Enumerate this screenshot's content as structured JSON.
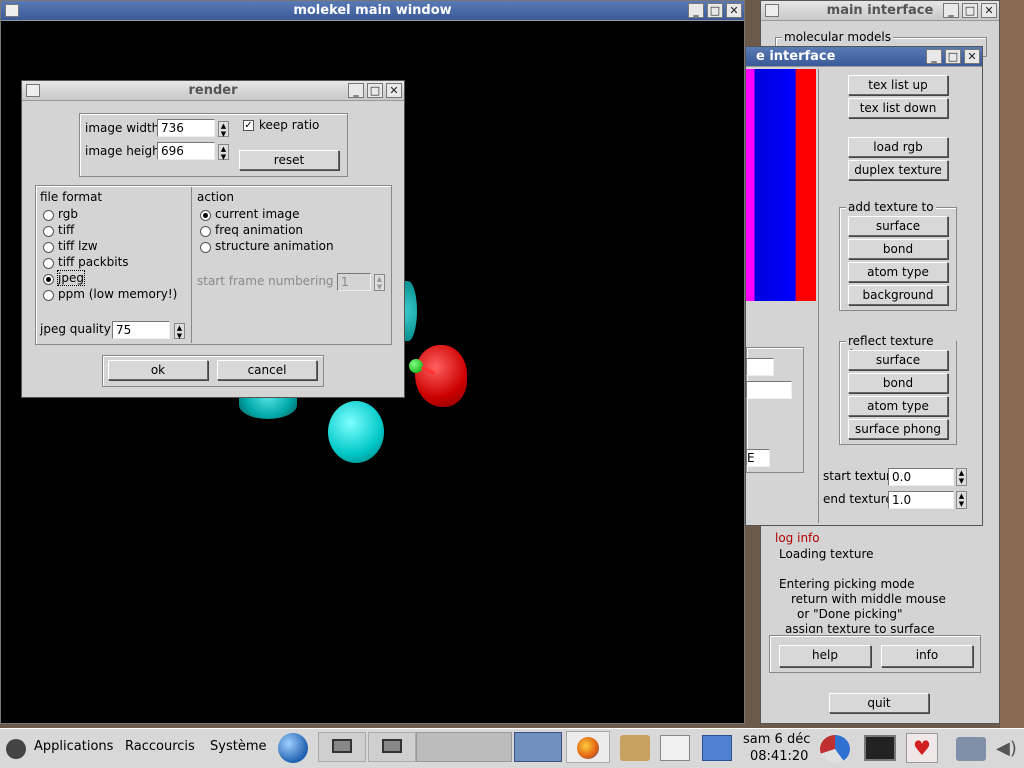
{
  "molekel_window": {
    "title": "molekel main window"
  },
  "render_dialog": {
    "title": "render",
    "image_width_label": "image width",
    "image_width_value": "736",
    "image_height_label": "image height",
    "image_height_value": "696",
    "keep_ratio_label": "keep ratio",
    "reset_label": "reset",
    "file_format_label": "file format",
    "formats": [
      "rgb",
      "tiff",
      "tiff lzw",
      "tiff packbits",
      "jpeg",
      "ppm (low memory!)"
    ],
    "selected_format": "jpeg",
    "action_label": "action",
    "actions": [
      "current image",
      "freq animation",
      "structure animation"
    ],
    "selected_action": "current image",
    "start_frame_label": "start frame numbering at",
    "start_frame_value": "1",
    "jpeg_quality_label": "jpeg quality",
    "jpeg_quality_value": "75",
    "ok_label": "ok",
    "cancel_label": "cancel"
  },
  "main_interface": {
    "title": "main interface",
    "molecular_models_label": "molecular models",
    "log_info_label": "log info",
    "log_lines": [
      "Loading texture",
      "",
      "Entering picking mode",
      "return with middle mouse",
      "or \"Done picking\"",
      "assign texture to surface"
    ],
    "help_label": "help",
    "info_label": "info",
    "quit_label": "quit"
  },
  "texture_interface": {
    "title": "e interface",
    "tex_list_up": "tex list up",
    "tex_list_down": "tex list down",
    "load_rgb": "load rgb",
    "duplex_texture": "duplex texture",
    "add_texture_to_label": "add texture to",
    "add_texture_items": [
      "surface",
      "bond",
      "atom type",
      "background"
    ],
    "reflect_texture_from_label": "reflect texture from",
    "reflect_texture_items": [
      "surface",
      "bond",
      "atom type",
      "surface phong"
    ],
    "start_texture_label": "start texture",
    "start_texture_value": "0.0",
    "end_texture_label": "end texture",
    "end_texture_value": "1.0",
    "partial_dropdown_text": "E"
  },
  "taskbar": {
    "menus": [
      "Applications",
      "Raccourcis",
      "Système"
    ],
    "date": "sam  6 déc",
    "time": "08:41:20"
  },
  "colors": {
    "selection_bg": "#5a7ab5",
    "log_label": "#b00000"
  }
}
